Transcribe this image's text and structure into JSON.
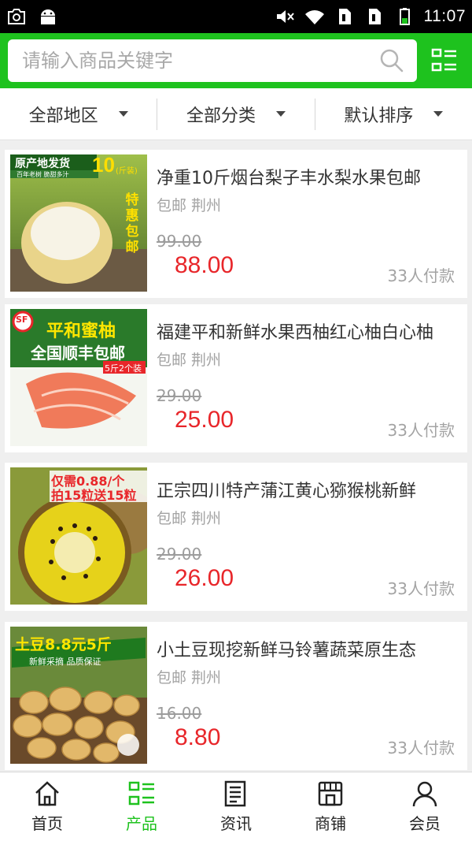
{
  "status_bar": {
    "time": "11:07"
  },
  "search": {
    "placeholder": "请输入商品关键字"
  },
  "filters": [
    {
      "label": "全部地区"
    },
    {
      "label": "全部分类"
    },
    {
      "label": "默认排序"
    }
  ],
  "products": [
    {
      "title": "净重10斤烟台梨子丰水梨水果包邮",
      "meta": "包邮 荆州",
      "original_price": "99.00",
      "price": "88.00",
      "sold": "33人付款",
      "image_text": {
        "tag": "原产地发货",
        "sub": "百年老树 脆甜多汁",
        "amount": "10",
        "unit": "(斤装)",
        "promo": "特惠包邮"
      }
    },
    {
      "title": "福建平和新鲜水果西柚红心柚白心柚",
      "meta": "包邮 荆州",
      "original_price": "29.00",
      "price": "25.00",
      "sold": "33人付款",
      "image_text": {
        "tag": "平和蜜柚",
        "sub": "全国顺丰包邮",
        "badge": "5斤2个装",
        "logo": "SF"
      }
    },
    {
      "title": "正宗四川特产蒲江黄心猕猴桃新鲜",
      "meta": "包邮 荆州",
      "original_price": "29.00",
      "price": "26.00",
      "sold": "33人付款",
      "image_text": {
        "tag": "仅需0.88/个",
        "sub": "拍15粒送15粒"
      }
    },
    {
      "title": "小土豆现挖新鲜马铃薯蔬菜原生态",
      "meta": "包邮 荆州",
      "original_price": "16.00",
      "price": "8.80",
      "sold": "33人付款",
      "image_text": {
        "tag": "土豆8.8元5斤",
        "sub": "新鲜采摘 品质保证"
      }
    }
  ],
  "nav": [
    {
      "label": "首页",
      "icon": "home-icon",
      "active": false
    },
    {
      "label": "产品",
      "icon": "product-list-icon",
      "active": true
    },
    {
      "label": "资讯",
      "icon": "news-icon",
      "active": false
    },
    {
      "label": "商铺",
      "icon": "shop-icon",
      "active": false
    },
    {
      "label": "会员",
      "icon": "user-icon",
      "active": false
    }
  ],
  "colors": {
    "accent": "#1ec21e",
    "price": "#e8262a",
    "muted": "#a3a3a3"
  }
}
